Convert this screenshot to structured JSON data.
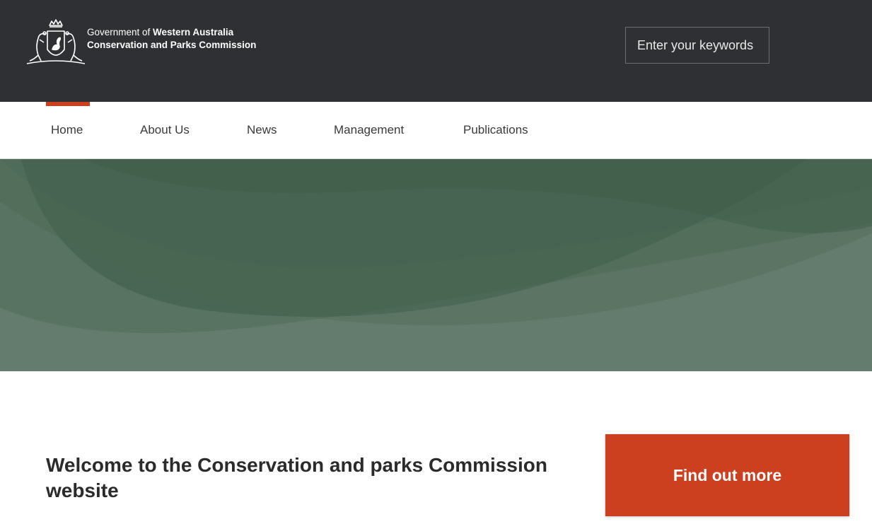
{
  "header": {
    "brand_line1_prefix": "Government of ",
    "brand_line1_bold": "Western Australia",
    "brand_line2": "Conservation and Parks Commission",
    "logo_icon": "wa-coat-of-arms-icon",
    "background_color": "#2f3033"
  },
  "search": {
    "placeholder": "Enter your keywords"
  },
  "nav": {
    "active_index": 0,
    "accent_color": "#c9411f",
    "items": [
      {
        "label": "Home"
      },
      {
        "label": "About Us"
      },
      {
        "label": "News"
      },
      {
        "label": "Management"
      },
      {
        "label": "Publications"
      }
    ]
  },
  "banner": {
    "color": "#5f7b69"
  },
  "main": {
    "welcome_text": "Welcome to the Conservation and parks Commission website",
    "cta_label": "Find out more",
    "cta_color": "#cc3f1f"
  }
}
